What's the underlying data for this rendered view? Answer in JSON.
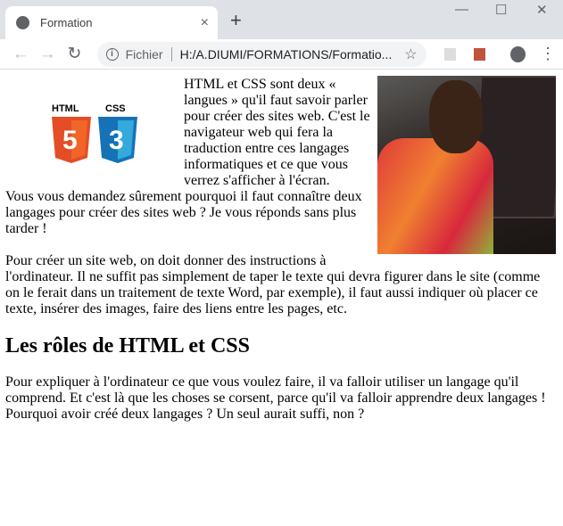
{
  "browser": {
    "tab_title": "Formation",
    "scheme": "Fichier",
    "url": "H:/A.DIUMI/FORMATIONS/Formatio...",
    "new_tab": "+",
    "close_tab": "×",
    "minimize": "—",
    "maximize": "☐",
    "close_window": "✕"
  },
  "content": {
    "logo_labels": [
      "HTML",
      "CSS"
    ],
    "intro": "HTML et CSS sont deux « langues » qu'il faut savoir parler pour créer des sites web. C'est le navigateur web qui fera la traduction entre ces langages informatiques et ce que vous verrez s'afficher à l'écran.",
    "intro2": "Vous vous demandez sûrement pourquoi il faut connaître deux langages pour créer des sites web ? Je vous réponds sans plus tarder !",
    "para2": "Pour créer un site web, on doit donner des instructions à l'ordinateur. Il ne suffit pas simplement de taper le texte qui devra figurer dans le site (comme on le ferait dans un traitement de texte Word, par exemple), il faut aussi indiquer où placer ce texte, insérer des images, faire des liens entre les pages, etc.",
    "heading": "Les rôles de HTML et CSS",
    "para3": "Pour expliquer à l'ordinateur ce que vous voulez faire, il va falloir utiliser un langage qu'il comprend. Et c'est là que les choses se corsent, parce qu'il va falloir apprendre deux langages ! Pourquoi avoir créé deux langages ? Un seul aurait suffi, non ?"
  }
}
